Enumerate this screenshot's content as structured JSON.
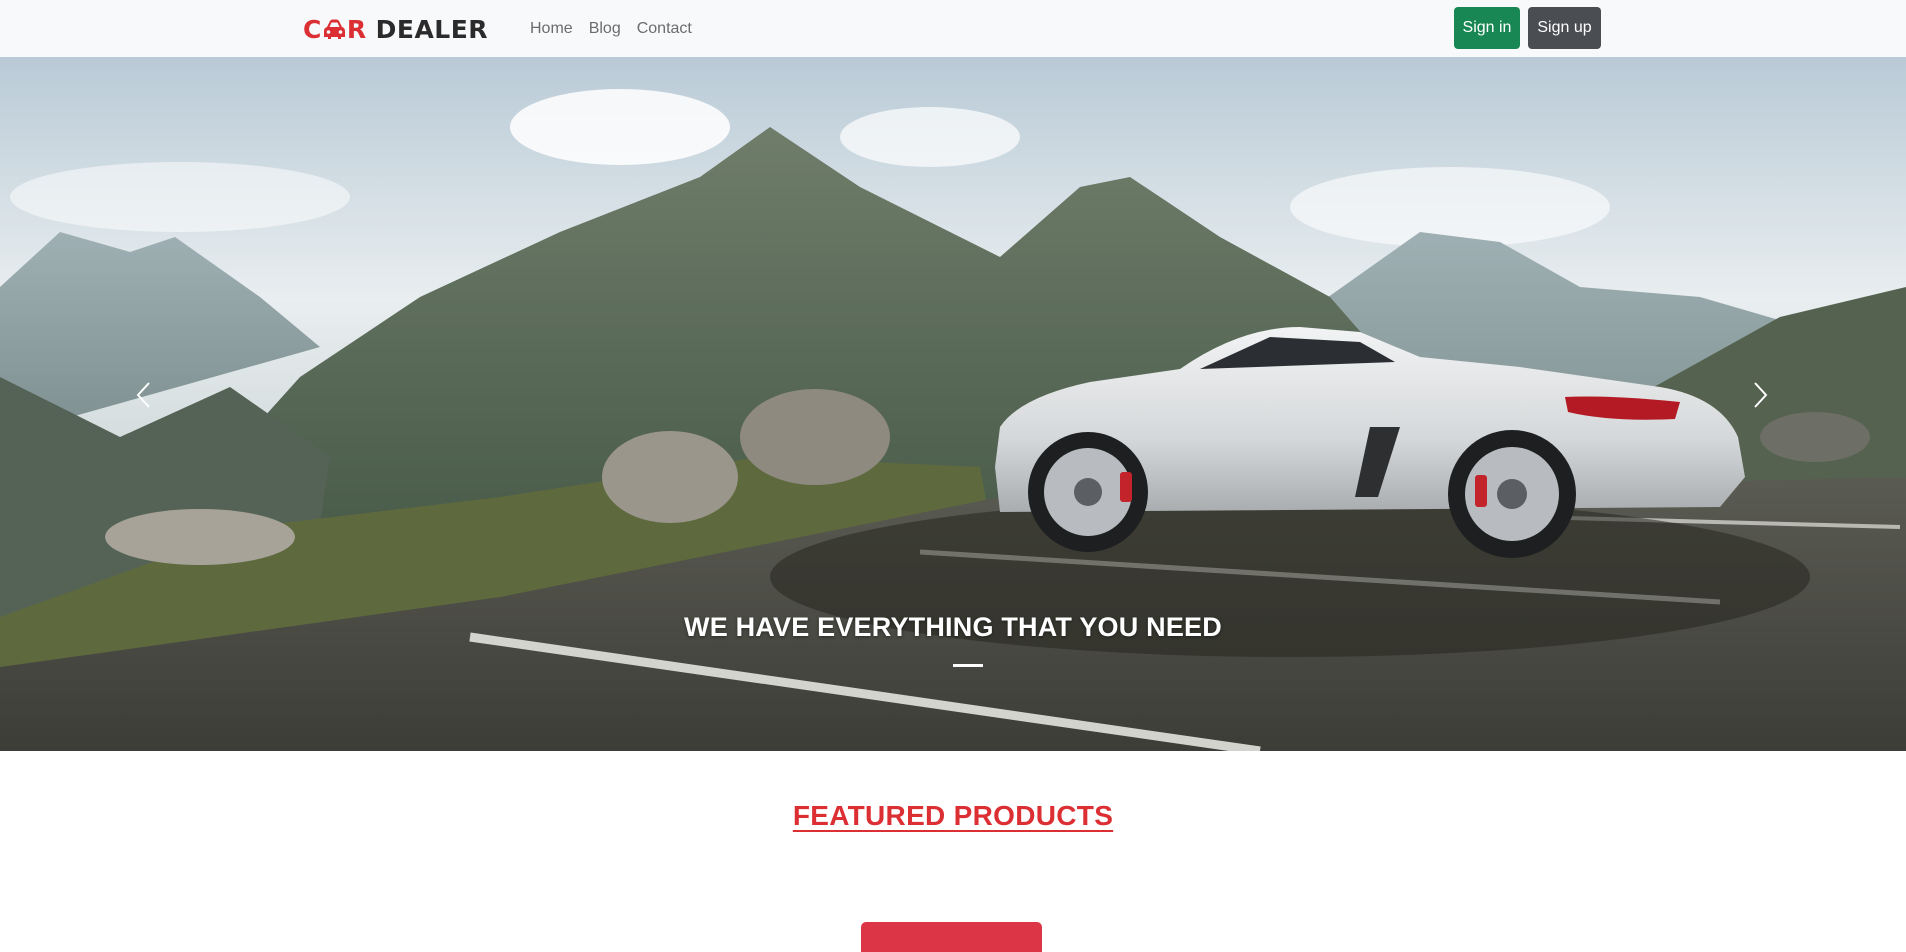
{
  "brand": {
    "part1": "C",
    "part2": "R",
    "part3": "DEALER",
    "logo_icon": "car-icon"
  },
  "nav": {
    "links": [
      {
        "label": "Home"
      },
      {
        "label": "Blog"
      },
      {
        "label": "Contact"
      }
    ],
    "signin_label": "Sign in",
    "signup_label": "Sign up"
  },
  "carousel": {
    "caption": "WE HAVE EVERYTHING THAT YOU NEED",
    "prev_icon": "chevron-left-icon",
    "next_icon": "chevron-right-icon",
    "slide_count": 1,
    "active_slide": 1
  },
  "featured": {
    "title": "FEATURED PRODUCTS"
  },
  "colors": {
    "brand_red": "#dc2f34",
    "signin_green": "#198754",
    "signup_gray": "#4a4d52",
    "nav_bg": "#f8f9fa"
  }
}
